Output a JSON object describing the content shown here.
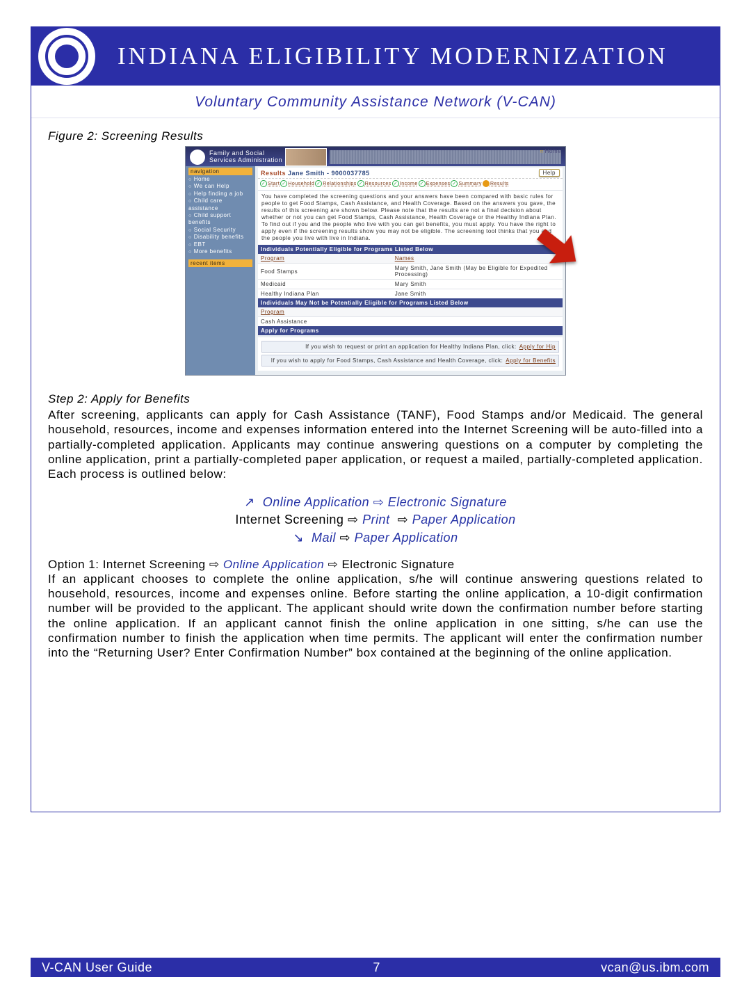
{
  "banner": {
    "title": "INDIANA ELIGIBILITY MODERNIZATION",
    "subtitle": "Voluntary Community Assistance Network (V-CAN)"
  },
  "figure_caption": "Figure 2: Screening Results",
  "screenshot": {
    "topbar": {
      "agency_line1": "Family and Social",
      "agency_line2": "Services Administration",
      "home": "Home"
    },
    "sidebar": {
      "nav_head": "navigation",
      "items": [
        "Home",
        "We can Help",
        "Help finding a job",
        "Child care assistance",
        "Child support benefits",
        "Social Security",
        "Disability benefits",
        "EBT",
        "More benefits"
      ],
      "recent_head": "recent items"
    },
    "results_line": {
      "label": "Results",
      "person": "Jane Smith - 9000037785",
      "help": "Help"
    },
    "steps": [
      {
        "label": "Start",
        "state": "completed"
      },
      {
        "label": "Household",
        "state": "completed"
      },
      {
        "label": "Relationships",
        "state": "completed"
      },
      {
        "label": "Resources",
        "state": "completed"
      },
      {
        "label": "Income",
        "state": "completed"
      },
      {
        "label": "Expenses",
        "state": "completed"
      },
      {
        "label": "Summary",
        "state": "completed"
      },
      {
        "label": "Results",
        "state": "current"
      }
    ],
    "intro_text": "You have completed the screening questions and your answers have been compared with basic rules for people to get Food Stamps, Cash Assistance, and Health Coverage. Based on the answers you gave, the results of this screening are shown below. Please note that the results are not a final decision about whether or not you can get Food Stamps, Cash Assistance, Health Coverage or the Healthy Indiana Plan. To find out if you and the people who live with you can get benefits, you must apply. You have the right to apply even if the screening results show you may not be eligible. The screening tool thinks that you and the people you live with live in Indiana.",
    "eligible": {
      "heading": "Individuals Potentially Eligible for Programs Listed Below",
      "col_program": "Program",
      "col_names": "Names",
      "rows": [
        {
          "program": "Food Stamps",
          "names": "Mary Smith, Jane Smith (May be Eligible for Expedited Processing)"
        },
        {
          "program": "Medicaid",
          "names": "Mary Smith"
        },
        {
          "program": "Healthy Indiana Plan",
          "names": "Jane Smith"
        }
      ]
    },
    "not_eligible": {
      "heading": "Individuals May Not be Potentially Eligible for Programs Listed Below",
      "col_program": "Program",
      "rows": [
        {
          "program": "Cash Assistance"
        }
      ]
    },
    "apply": {
      "heading": "Apply for Programs",
      "items": [
        {
          "text": "If you wish to request or print an application for Healthy Indiana Plan, click:",
          "link": "Apply for Hip"
        },
        {
          "text": "If you wish to apply for Food Stamps, Cash Assistance and Health Coverage, click:",
          "link": "Apply for Benefits"
        }
      ]
    }
  },
  "step2_heading": "Step 2: Apply for Benefits",
  "step2_para": "After screening, applicants can apply for Cash Assistance (TANF), Food Stamps and/or Medicaid. The general household, resources, income and expenses information entered into the Internet Screening will be auto-filled into a partially-completed application. Applicants may continue answering questions on a computer by completing the online application, print a partially-completed paper application, or request a mailed, partially-completed application. Each process is outlined below:",
  "flow": {
    "leading": "Internet Screening ",
    "line1_arrow": "↗",
    "line1_a": "Online Application",
    "line1_b": "Electronic Signature",
    "line2_a": "Print",
    "line2_b": "Paper Application",
    "line3_arrow": "↘",
    "line3_a": "Mail",
    "line3_b": "Paper Application",
    "imply": "⇨"
  },
  "option1_heading_prefix": "Option 1:  Internet Screening ",
  "option1_heading_mid": "Online Application",
  "option1_heading_suffix": " Electronic Signature",
  "option1_para": "If an applicant chooses to complete the online application, s/he will continue answering questions related to household, resources, income and expenses online. Before starting the online application, a 10-digit confirmation number will be provided to the applicant. The applicant should write down the confirmation number before starting the online application. If an applicant cannot finish the online application in one sitting, s/he can use the confirmation number to finish the application when time permits. The applicant will enter the confirmation number into the “Returning User? Enter Confirmation Number” box contained at the beginning of the online application.",
  "footer": {
    "left": "V-CAN User Guide",
    "center": "7",
    "right": "vcan@us.ibm.com"
  }
}
